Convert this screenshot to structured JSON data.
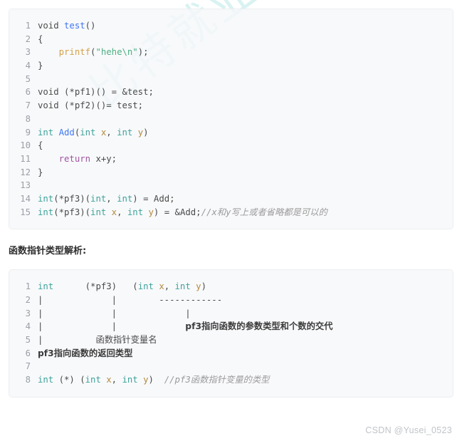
{
  "watermark": {
    "text": "比特就业课",
    "color": "#d9f2f2"
  },
  "theme": {
    "page_background": "#ffffff",
    "code_background": "#f6f8fa",
    "code_border": "#eceef0",
    "line_number_color": "#9aa0a6",
    "keyword_color": "#4d4d4c",
    "type_color": "#3fa39b",
    "function_color": "#4078f2",
    "call_color": "#d4a14a",
    "string_color": "#4caf82",
    "return_color": "#a054a0",
    "variable_color": "#b38b3f",
    "comment_color": "#9b9b9b",
    "footer_color": "#c0c4c8"
  },
  "code_block_1": {
    "language": "c",
    "line_numbers": [
      "1",
      "2",
      "3",
      "4",
      "5",
      "6",
      "7",
      "8",
      "9",
      "10",
      "11",
      "12",
      "13",
      "14",
      "15"
    ],
    "lines": [
      {
        "n": "1",
        "tokens": [
          {
            "t": "void",
            "c": "kw"
          },
          {
            "t": " ",
            "c": "plain"
          },
          {
            "t": "test",
            "c": "fn"
          },
          {
            "t": "()",
            "c": "plain"
          }
        ]
      },
      {
        "n": "2",
        "tokens": [
          {
            "t": "{",
            "c": "plain"
          }
        ]
      },
      {
        "n": "3",
        "tokens": [
          {
            "t": "    ",
            "c": "plain"
          },
          {
            "t": "printf",
            "c": "call"
          },
          {
            "t": "(",
            "c": "plain"
          },
          {
            "t": "\"hehe\\n\"",
            "c": "str"
          },
          {
            "t": ");",
            "c": "plain"
          }
        ]
      },
      {
        "n": "4",
        "tokens": [
          {
            "t": "}",
            "c": "plain"
          }
        ]
      },
      {
        "n": "5",
        "tokens": []
      },
      {
        "n": "6",
        "tokens": [
          {
            "t": "void",
            "c": "kw"
          },
          {
            "t": " (*pf1)() = &test;",
            "c": "plain"
          }
        ]
      },
      {
        "n": "7",
        "tokens": [
          {
            "t": "void",
            "c": "kw"
          },
          {
            "t": " (*pf2)()= test;",
            "c": "plain"
          }
        ]
      },
      {
        "n": "8",
        "tokens": []
      },
      {
        "n": "9",
        "tokens": [
          {
            "t": "int",
            "c": "type"
          },
          {
            "t": " ",
            "c": "plain"
          },
          {
            "t": "Add",
            "c": "fn"
          },
          {
            "t": "(",
            "c": "plain"
          },
          {
            "t": "int",
            "c": "type"
          },
          {
            "t": " ",
            "c": "plain"
          },
          {
            "t": "x",
            "c": "var"
          },
          {
            "t": ", ",
            "c": "plain"
          },
          {
            "t": "int",
            "c": "type"
          },
          {
            "t": " ",
            "c": "plain"
          },
          {
            "t": "y",
            "c": "var"
          },
          {
            "t": ")",
            "c": "plain"
          }
        ]
      },
      {
        "n": "10",
        "tokens": [
          {
            "t": "{",
            "c": "plain"
          }
        ]
      },
      {
        "n": "11",
        "tokens": [
          {
            "t": "    ",
            "c": "plain"
          },
          {
            "t": "return",
            "c": "ret"
          },
          {
            "t": " x+y;",
            "c": "plain"
          }
        ]
      },
      {
        "n": "12",
        "tokens": [
          {
            "t": "}",
            "c": "plain"
          }
        ]
      },
      {
        "n": "13",
        "tokens": []
      },
      {
        "n": "14",
        "tokens": [
          {
            "t": "int",
            "c": "type"
          },
          {
            "t": "(*pf3)(",
            "c": "plain"
          },
          {
            "t": "int",
            "c": "type"
          },
          {
            "t": ", ",
            "c": "plain"
          },
          {
            "t": "int",
            "c": "type"
          },
          {
            "t": ") = Add;",
            "c": "plain"
          }
        ]
      },
      {
        "n": "15",
        "tokens": [
          {
            "t": "int",
            "c": "type"
          },
          {
            "t": "(*pf3)(",
            "c": "plain"
          },
          {
            "t": "int",
            "c": "type"
          },
          {
            "t": " ",
            "c": "plain"
          },
          {
            "t": "x",
            "c": "var"
          },
          {
            "t": ", ",
            "c": "plain"
          },
          {
            "t": "int",
            "c": "type"
          },
          {
            "t": " ",
            "c": "plain"
          },
          {
            "t": "y",
            "c": "var"
          },
          {
            "t": ") = &Add;",
            "c": "plain"
          },
          {
            "t": "//x和y写上或者省略都是可以的",
            "c": "cmt"
          }
        ]
      }
    ]
  },
  "heading": {
    "text": "函数指针类型解析:"
  },
  "code_block_2": {
    "language": "text",
    "line_numbers": [
      "1",
      "2",
      "3",
      "4",
      "5",
      "6",
      "7",
      "8"
    ],
    "lines": [
      {
        "n": "1",
        "tokens": [
          {
            "t": "int",
            "c": "type"
          },
          {
            "t": "      (*pf3)   (",
            "c": "plain"
          },
          {
            "t": "int",
            "c": "type"
          },
          {
            "t": " ",
            "c": "plain"
          },
          {
            "t": "x",
            "c": "var"
          },
          {
            "t": ", ",
            "c": "plain"
          },
          {
            "t": "int",
            "c": "type"
          },
          {
            "t": " ",
            "c": "plain"
          },
          {
            "t": "y",
            "c": "var"
          },
          {
            "t": ")",
            "c": "plain"
          }
        ]
      },
      {
        "n": "2",
        "tokens": [
          {
            "t": "|             |        ------------",
            "c": "plain"
          }
        ]
      },
      {
        "n": "3",
        "tokens": [
          {
            "t": "|             |             |",
            "c": "plain"
          }
        ]
      },
      {
        "n": "4",
        "tokens": [
          {
            "t": "|             |             ",
            "c": "plain"
          },
          {
            "t": "pf3指向函数的参数类型和个数的交代",
            "c": "cn-b"
          }
        ]
      },
      {
        "n": "5",
        "tokens": [
          {
            "t": "|          ",
            "c": "plain"
          },
          {
            "t": "函数指针变量名",
            "c": "cn"
          }
        ]
      },
      {
        "n": "6",
        "tokens": [
          {
            "t": "pf3指向函数的返回类型",
            "c": "cn-b"
          }
        ]
      },
      {
        "n": "7",
        "tokens": []
      },
      {
        "n": "8",
        "tokens": [
          {
            "t": "int",
            "c": "type"
          },
          {
            "t": " (*) (",
            "c": "plain"
          },
          {
            "t": "int",
            "c": "type"
          },
          {
            "t": " ",
            "c": "plain"
          },
          {
            "t": "x",
            "c": "var"
          },
          {
            "t": ", ",
            "c": "plain"
          },
          {
            "t": "int",
            "c": "type"
          },
          {
            "t": " ",
            "c": "plain"
          },
          {
            "t": "y",
            "c": "var"
          },
          {
            "t": ")  ",
            "c": "plain"
          },
          {
            "t": "//pf3函数指针变量的类型",
            "c": "cmt"
          }
        ]
      }
    ]
  },
  "footer": {
    "text": "CSDN @Yusei_0523"
  }
}
